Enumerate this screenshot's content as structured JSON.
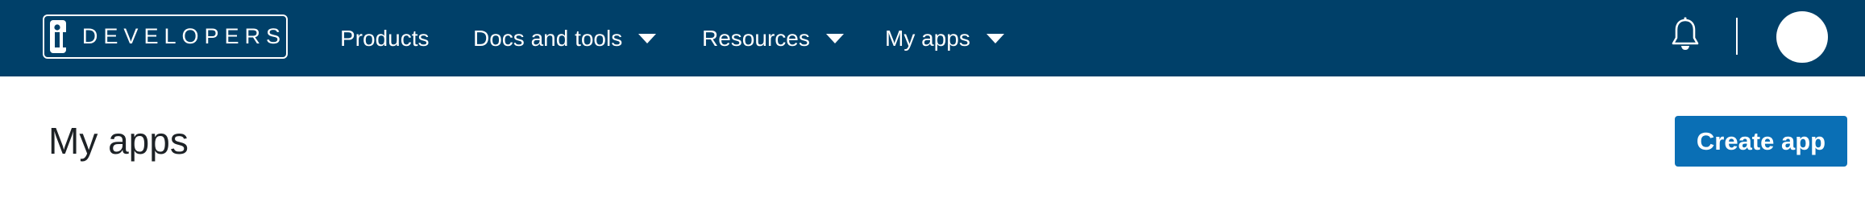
{
  "header": {
    "logo": {
      "mark_text": "in",
      "wordmark": "DEVELOPERS"
    },
    "nav": [
      {
        "label": "Products",
        "has_dropdown": false
      },
      {
        "label": "Docs and tools",
        "has_dropdown": true
      },
      {
        "label": "Resources",
        "has_dropdown": true
      },
      {
        "label": "My apps",
        "has_dropdown": true
      }
    ],
    "icons": {
      "notifications": "bell-icon",
      "profile": "avatar"
    },
    "colors": {
      "bar_background": "#004069",
      "text": "#ffffff"
    }
  },
  "main": {
    "title": "My apps",
    "create_button_label": "Create app",
    "colors": {
      "primary_button": "#0a6fb5"
    }
  }
}
